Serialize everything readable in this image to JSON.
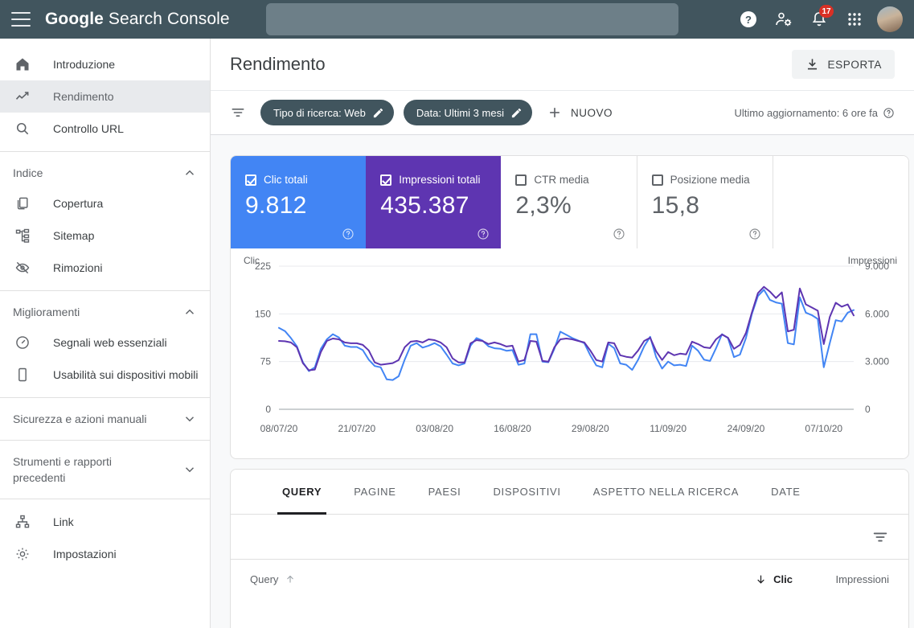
{
  "appbar": {
    "brand_bold": "Google",
    "brand_rest": " Search Console",
    "search_placeholder": "",
    "search_value": "",
    "menu_icon": "hamburger-icon",
    "help_icon": "help-icon",
    "accounts_icon": "user-settings-icon",
    "bell_icon": "notifications-icon",
    "notification_count": "17",
    "apps_icon": "apps-grid-icon",
    "avatar_icon": "avatar"
  },
  "sidebar": {
    "top_items": [
      {
        "label": "Introduzione",
        "icon": "home-icon",
        "active": false
      },
      {
        "label": "Rendimento",
        "icon": "trending-up-icon",
        "active": true
      },
      {
        "label": "Controllo URL",
        "icon": "search-icon",
        "active": false
      }
    ],
    "groups": [
      {
        "label": "Indice",
        "expanded": true,
        "items": [
          {
            "label": "Copertura",
            "icon": "pages-icon"
          },
          {
            "label": "Sitemap",
            "icon": "sitemap-icon"
          },
          {
            "label": "Rimozioni",
            "icon": "eye-off-icon"
          }
        ]
      },
      {
        "label": "Miglioramenti",
        "expanded": true,
        "items": [
          {
            "label": "Segnali web essenziali",
            "icon": "speedometer-icon"
          },
          {
            "label": "Usabilità sui dispositivi mobili",
            "icon": "mobile-icon"
          }
        ]
      },
      {
        "label": "Sicurezza e azioni manuali",
        "expanded": false,
        "items": []
      },
      {
        "label": "Strumenti e rapporti precedenti",
        "expanded": false,
        "items": []
      }
    ],
    "bottom_items": [
      {
        "label": "Link",
        "icon": "link-tree-icon"
      },
      {
        "label": "Impostazioni",
        "icon": "gear-icon"
      }
    ]
  },
  "page": {
    "title": "Rendimento",
    "export_label": "ESPORTA",
    "export_icon": "download-icon"
  },
  "filters": {
    "filter_icon": "filter-icon",
    "chips": [
      {
        "label": "Tipo di ricerca: Web",
        "edit_icon": "pencil-icon"
      },
      {
        "label": "Data: Ultimi 3 mesi",
        "edit_icon": "pencil-icon"
      }
    ],
    "new_label": "NUOVO",
    "new_icon": "plus-icon",
    "updated_text": "Ultimo aggiornamento: 6 ore fa",
    "updated_help_icon": "help-outline-icon"
  },
  "metrics": [
    {
      "label": "Clic totali",
      "value": "9.812",
      "checked": true,
      "style": "on-blue",
      "help_icon": "help-outline-icon"
    },
    {
      "label": "Impressioni totali",
      "value": "435.387",
      "checked": true,
      "style": "on-purple",
      "help_icon": "help-outline-icon"
    },
    {
      "label": "CTR media",
      "value": "2,3%",
      "checked": false,
      "style": "",
      "help_icon": "help-outline-icon"
    },
    {
      "label": "Posizione media",
      "value": "15,8",
      "checked": false,
      "style": "",
      "help_icon": "help-outline-icon"
    }
  ],
  "colors": {
    "appbar": "#41555e",
    "clicks": "#4285f4",
    "impressions": "#5e35b1",
    "accent_blue_card": "#4285f4",
    "accent_purple_card": "#5e35b1",
    "badge_red": "#d93025"
  },
  "chart_data": {
    "type": "line",
    "title": "",
    "ylabel": "Clic",
    "y2label": "Impressioni",
    "xlabel": "",
    "ylim": [
      0,
      225
    ],
    "y2lim": [
      0,
      9000
    ],
    "yticks": [
      "0",
      "75",
      "150",
      "225"
    ],
    "y2ticks": [
      "0",
      "3.000",
      "6.000",
      "9.000"
    ],
    "xtick_labels": [
      "08/07/20",
      "21/07/20",
      "03/08/20",
      "16/08/20",
      "29/08/20",
      "11/09/20",
      "24/09/20",
      "07/10/20"
    ],
    "xtick_indices": [
      0,
      13,
      26,
      39,
      52,
      65,
      78,
      91
    ],
    "grid": true,
    "legend": "none",
    "series": [
      {
        "name": "Clic",
        "color": "#4285f4",
        "axis": "left",
        "values": [
          128,
          123,
          112,
          99,
          74,
          60,
          66,
          95,
          110,
          118,
          113,
          100,
          98,
          98,
          93,
          78,
          68,
          66,
          47,
          46,
          52,
          78,
          100,
          104,
          97,
          100,
          104,
          99,
          86,
          72,
          69,
          72,
          100,
          112,
          108,
          99,
          96,
          95,
          92,
          93,
          70,
          72,
          118,
          118,
          75,
          74,
          95,
          122,
          117,
          112,
          108,
          104,
          85,
          69,
          66,
          103,
          96,
          72,
          70,
          62,
          78,
          99,
          114,
          82,
          64,
          75,
          69,
          70,
          68,
          100,
          92,
          78,
          76,
          96,
          118,
          112,
          82,
          86,
          112,
          150,
          178,
          188,
          172,
          168,
          166,
          104,
          102,
          176,
          152,
          148,
          142,
          66,
          104,
          140,
          138,
          152,
          156
        ]
      },
      {
        "name": "Impressioni",
        "color": "#5e35b1",
        "axis": "right",
        "values": [
          4300,
          4280,
          4200,
          3900,
          2900,
          2450,
          2500,
          3600,
          4300,
          4450,
          4400,
          4200,
          4150,
          4150,
          4050,
          3700,
          2950,
          2800,
          2850,
          2900,
          3100,
          3900,
          4250,
          4300,
          4200,
          4400,
          4350,
          4200,
          3900,
          3200,
          2950,
          2950,
          4150,
          4350,
          4300,
          4100,
          4200,
          4100,
          3950,
          4000,
          3000,
          3100,
          4300,
          4250,
          3050,
          3000,
          3900,
          4400,
          4450,
          4400,
          4300,
          4200,
          3700,
          3100,
          3000,
          4200,
          4150,
          3400,
          3300,
          3250,
          3700,
          4300,
          4500,
          3650,
          3100,
          3600,
          3400,
          3500,
          3450,
          4250,
          4100,
          3900,
          3850,
          4400,
          4700,
          4500,
          3800,
          4050,
          4800,
          6100,
          7300,
          7700,
          7400,
          7000,
          7350,
          4900,
          5000,
          7600,
          6600,
          6400,
          6200,
          4100,
          5800,
          6700,
          6450,
          6600,
          5900
        ]
      }
    ]
  },
  "tabs": [
    {
      "label": "QUERY",
      "active": true
    },
    {
      "label": "PAGINE",
      "active": false
    },
    {
      "label": "PAESI",
      "active": false
    },
    {
      "label": "DISPOSITIVI",
      "active": false
    },
    {
      "label": "ASPETTO NELLA RICERCA",
      "active": false
    },
    {
      "label": "DATE",
      "active": false
    }
  ],
  "table": {
    "filter_icon": "filter-list-icon",
    "columns": [
      {
        "label": "Query",
        "sort_icon": "arrow-up-icon",
        "sorted": false
      },
      {
        "label": "Clic",
        "sort_icon": "arrow-down-icon",
        "sorted": true
      },
      {
        "label": "Impressioni",
        "sort_icon": "",
        "sorted": false
      }
    ],
    "rows": []
  }
}
